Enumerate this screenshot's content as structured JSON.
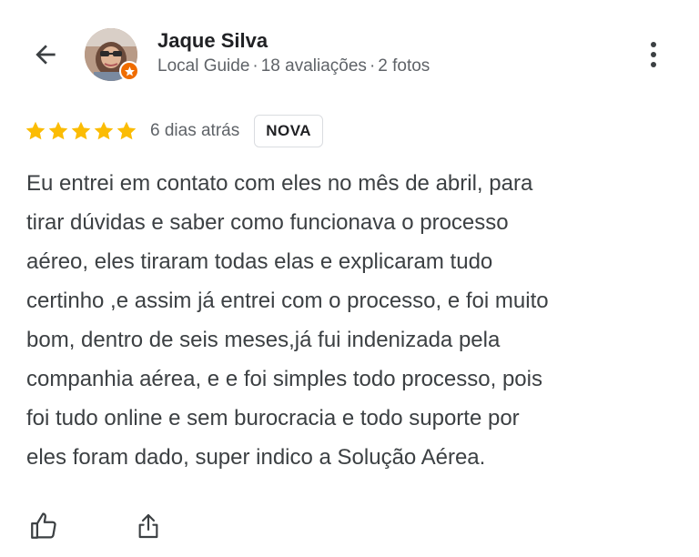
{
  "header": {
    "back_icon": "arrow-back-icon",
    "more_icon": "more-vert-icon"
  },
  "user": {
    "name": "Jaque Silva",
    "role": "Local Guide",
    "reviews": "18 avaliações",
    "photos": "2 fotos",
    "separator": "·",
    "avatar_icon": "user-avatar",
    "badge_icon": "local-guide-star-icon",
    "badge_color": "#ef6c00"
  },
  "review": {
    "rating": 5,
    "rating_max": 5,
    "star_color": "#fbbc04",
    "date": "6 dias atrás",
    "badge_label": "NOVA",
    "text": "Eu entrei em contato com eles no mês de abril, para\ntirar dúvidas e saber como funcionava o processo\naéreo, eles tiraram todas elas e explicaram tudo\ncertinho ,e assim já entrei com o processo, e foi muito\nbom, dentro de seis meses,já fui indenizada pela\ncompanhia aérea, e e foi simples todo processo, pois\nfoi tudo online e sem burocracia e todo suporte por\neles foram dado, super indico a Solução Aérea."
  },
  "actions": {
    "like_icon": "thumb-up-icon",
    "share_icon": "share-icon"
  }
}
